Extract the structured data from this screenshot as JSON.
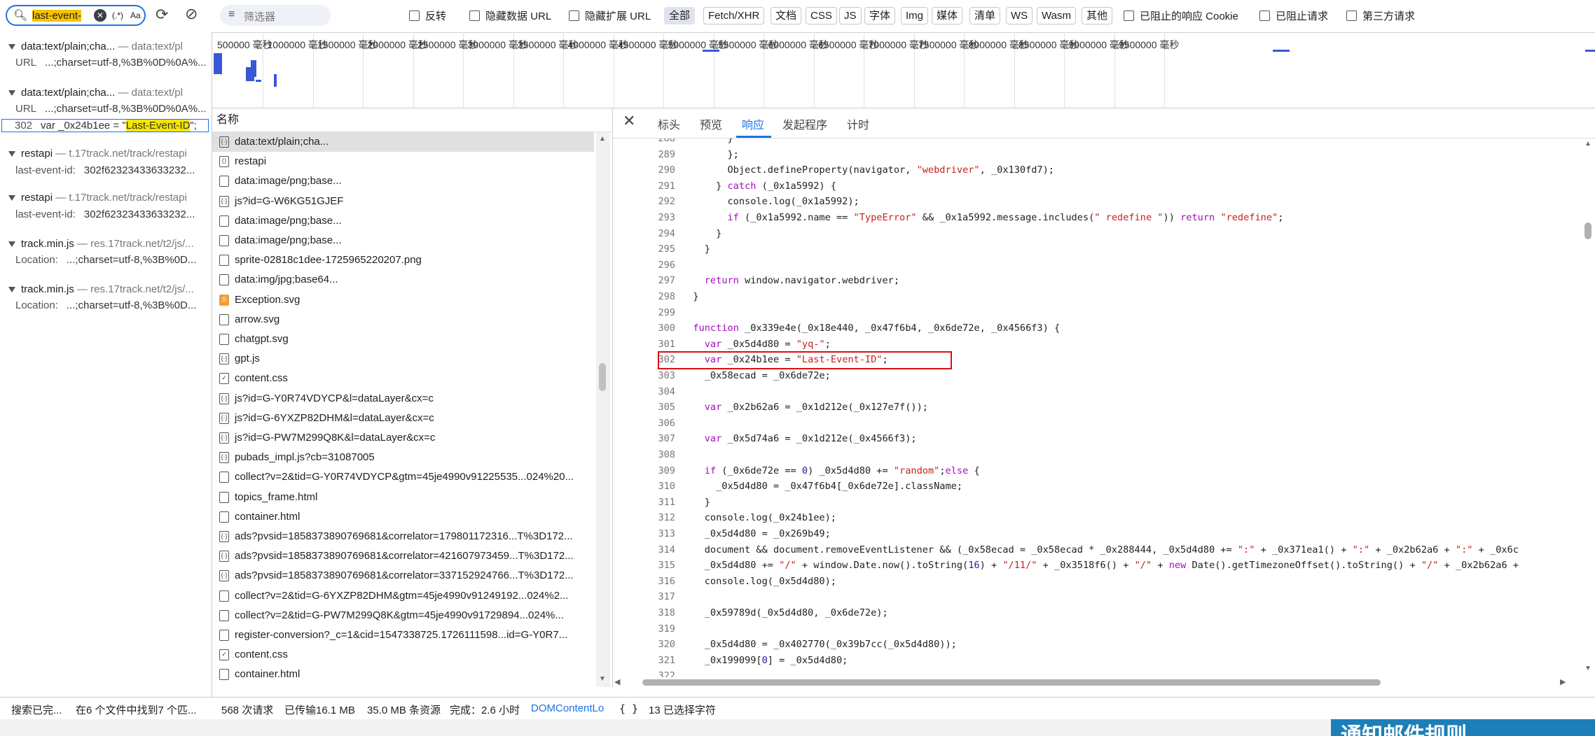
{
  "toolbar": {
    "search_query": "last-event-",
    "regex_label": "(.*)",
    "case_label": "Aa",
    "filter_placeholder": "筛选器",
    "checkboxes": [
      "反转",
      "隐藏数据 URL",
      "隐藏扩展 URL"
    ],
    "type_buttons": [
      "全部",
      "Fetch/XHR",
      "文档",
      "CSS",
      "JS",
      "字体",
      "Img",
      "媒体",
      "清单",
      "WS",
      "Wasm",
      "其他"
    ],
    "active_type": "全部",
    "right_checkboxes": [
      "已阻止的响应 Cookie",
      "已阻止请求",
      "第三方请求"
    ]
  },
  "search_results": [
    {
      "file": "data:text/plain;cha...",
      "source": "— data:text/pl",
      "lines": [
        {
          "label": "URL",
          "text": "...;charset=utf-8,%3B%0D%0A%..."
        }
      ]
    },
    {
      "file": "data:text/plain;cha...",
      "source": "— data:text/pl",
      "lines": [
        {
          "label": "URL",
          "text": "...;charset=utf-8,%3B%0D%0A%..."
        },
        {
          "label": "302",
          "pre": "var _0x24b1ee = \"",
          "match": "Last-Event-ID",
          "post": "\";"
        }
      ]
    },
    {
      "file": "restapi",
      "source": "— t.17track.net/track/restapi",
      "lines": [
        {
          "label": "last-event-id:",
          "text": "302f62323433633232..."
        }
      ]
    },
    {
      "file": "restapi",
      "source": "— t.17track.net/track/restapi",
      "lines": [
        {
          "label": "last-event-id:",
          "text": "302f62323433633232..."
        }
      ]
    },
    {
      "file": "track.min.js",
      "source": "— res.17track.net/t2/js/...",
      "lines": [
        {
          "label": "Location:",
          "text": "...;charset=utf-8,%3B%0D..."
        }
      ]
    },
    {
      "file": "track.min.js",
      "source": "— res.17track.net/t2/js/...",
      "lines": [
        {
          "label": "Location:",
          "text": "...;charset=utf-8,%3B%0D..."
        }
      ]
    }
  ],
  "timeline_ticks": [
    "500000 毫秒",
    "1000000 毫秒",
    "1500000 毫秒",
    "2000000 毫秒",
    "2500000 毫秒",
    "3000000 毫秒",
    "3500000 毫秒",
    "4000000 毫秒",
    "4500000 毫秒",
    "5000000 毫秒",
    "5500000 毫秒",
    "6000000 毫秒",
    "6500000 毫秒",
    "7000000 毫秒",
    "7500000 毫秒",
    "8000000 毫秒",
    "8500000 毫秒",
    "9000000 毫秒",
    "9500000 毫秒"
  ],
  "request_list": {
    "header": "名称",
    "rows": [
      {
        "icon": "data-icon",
        "name": "data:text/plain;cha..."
      },
      {
        "icon": "fetch-icon",
        "name": "restapi"
      },
      {
        "icon": "file-icon",
        "name": "data:image/png;base..."
      },
      {
        "icon": "script-icon",
        "name": "js?id=G-W6KG51GJEF"
      },
      {
        "icon": "file-icon",
        "name": "data:image/png;base..."
      },
      {
        "icon": "file-icon",
        "name": "data:image/png;base..."
      },
      {
        "icon": "file-icon",
        "name": "sprite-02818c1dee-1725965220207.png"
      },
      {
        "icon": "file-icon",
        "name": "data:img/jpg;base64..."
      },
      {
        "icon": "svg-icon",
        "name": "Exception.svg"
      },
      {
        "icon": "file-icon",
        "name": "arrow.svg"
      },
      {
        "icon": "file-icon",
        "name": "chatgpt.svg"
      },
      {
        "icon": "script-icon",
        "name": "gpt.js"
      },
      {
        "icon": "css-icon",
        "name": "content.css"
      },
      {
        "icon": "script-icon",
        "name": "js?id=G-Y0R74VDYCP&l=dataLayer&cx=c"
      },
      {
        "icon": "script-icon",
        "name": "js?id=G-6YXZP82DHM&l=dataLayer&cx=c"
      },
      {
        "icon": "script-icon",
        "name": "js?id=G-PW7M299Q8K&l=dataLayer&cx=c"
      },
      {
        "icon": "script-icon",
        "name": "pubads_impl.js?cb=31087005"
      },
      {
        "icon": "file-icon",
        "name": "collect?v=2&tid=G-Y0R74VDYCP&gtm=45je4990v91225535...024%20..."
      },
      {
        "icon": "file-icon",
        "name": "topics_frame.html"
      },
      {
        "icon": "file-icon",
        "name": "container.html"
      },
      {
        "icon": "script-icon",
        "name": "ads?pvsid=1858373890769681&correlator=179801172316...T%3D172..."
      },
      {
        "icon": "script-icon",
        "name": "ads?pvsid=1858373890769681&correlator=421607973459...T%3D172..."
      },
      {
        "icon": "script-icon",
        "name": "ads?pvsid=1858373890769681&correlator=337152924766...T%3D172..."
      },
      {
        "icon": "file-icon",
        "name": "collect?v=2&tid=G-6YXZP82DHM&gtm=45je4990v91249192...024%2..."
      },
      {
        "icon": "file-icon",
        "name": "collect?v=2&tid=G-PW7M299Q8K&gtm=45je4990v91729894...024%..."
      },
      {
        "icon": "file-icon",
        "name": "register-conversion?_c=1&cid=1547338725.1726111598...id=G-Y0R7..."
      },
      {
        "icon": "css-icon",
        "name": "content.css"
      },
      {
        "icon": "file-icon",
        "name": "container.html"
      }
    ]
  },
  "detail_tabs": [
    "标头",
    "预览",
    "响应",
    "发起程序",
    "计时"
  ],
  "active_tab": "响应",
  "code_lines": [
    {
      "n": "288",
      "t": "        }"
    },
    {
      "n": "289",
      "t": "        };"
    },
    {
      "n": "290",
      "t": "        Object.defineProperty(navigator, \"webdriver\", _0x130fd7);"
    },
    {
      "n": "291",
      "t": "      } catch (_0x1a5992) {"
    },
    {
      "n": "292",
      "t": "        console.log(_0x1a5992);"
    },
    {
      "n": "293",
      "t": "        if (_0x1a5992.name == \"TypeError\" && _0x1a5992.message.includes(\" redefine \")) return \"redefine\";"
    },
    {
      "n": "294",
      "t": "      }"
    },
    {
      "n": "295",
      "t": "    }"
    },
    {
      "n": "296",
      "t": ""
    },
    {
      "n": "297",
      "t": "    return window.navigator.webdriver;"
    },
    {
      "n": "298",
      "t": "  }"
    },
    {
      "n": "299",
      "t": ""
    },
    {
      "n": "300",
      "t": "  function _0x339e4e(_0x18e440, _0x47f6b4, _0x6de72e, _0x4566f3) {"
    },
    {
      "n": "301",
      "t": "    var _0x5d4d80 = \"yq-\";"
    },
    {
      "n": "302",
      "t": "    var _0x24b1ee = \"Last-Event-ID\";"
    },
    {
      "n": "303",
      "t": "    _0x58ecad = _0x6de72e;"
    },
    {
      "n": "304",
      "t": ""
    },
    {
      "n": "305",
      "t": "    var _0x2b62a6 = _0x1d212e(_0x127e7f());"
    },
    {
      "n": "306",
      "t": ""
    },
    {
      "n": "307",
      "t": "    var _0x5d74a6 = _0x1d212e(_0x4566f3);"
    },
    {
      "n": "308",
      "t": ""
    },
    {
      "n": "309",
      "t": "    if (_0x6de72e == 0) _0x5d4d80 += \"random\";else {"
    },
    {
      "n": "310",
      "t": "      _0x5d4d80 = _0x47f6b4[_0x6de72e].className;"
    },
    {
      "n": "311",
      "t": "    }"
    },
    {
      "n": "312",
      "t": "    console.log(_0x24b1ee);"
    },
    {
      "n": "313",
      "t": "    _0x5d4d80 = _0x269b49;"
    },
    {
      "n": "314",
      "t": "    document && document.removeEventListener && (_0x58ecad = _0x58ecad * _0x288444, _0x5d4d80 += \":\" + _0x371ea1() + \":\" + _0x2b62a6 + \":\" + _0x6c"
    },
    {
      "n": "315",
      "t": "    _0x5d4d80 += \"/\" + window.Date.now().toString(16) + \"/11/\" + _0x3518f6() + \"/\" + new Date().getTimezoneOffset().toString() + \"/\" + _0x2b62a6 +"
    },
    {
      "n": "316",
      "t": "    console.log(_0x5d4d80);"
    },
    {
      "n": "317",
      "t": ""
    },
    {
      "n": "318",
      "t": "    _0x59789d(_0x5d4d80, _0x6de72e);"
    },
    {
      "n": "319",
      "t": ""
    },
    {
      "n": "320",
      "t": "    _0x5d4d80 = _0x402770(_0x39b7cc(_0x5d4d80));"
    },
    {
      "n": "321",
      "t": "    _0x199099[0] = _0x5d4d80;"
    },
    {
      "n": "322",
      "t": ""
    }
  ],
  "status_bar": {
    "search_status": "搜索已完...",
    "search_summary": "在6 个文件中找到7 个匹...",
    "requests": "568 次请求",
    "transferred": "已传输16.1 MB",
    "resources": "35.0 MB 条资源",
    "finish": "完成：2.6 小时",
    "dcl": "DOMContentLo",
    "format_label": "{ }",
    "selection": "13 已选择字符"
  },
  "bottom_banner_text": "通知邮件规则",
  "colors": {
    "accent": "#1a73e8",
    "highlight": "#f5e600",
    "redbox": "#d80f16"
  }
}
